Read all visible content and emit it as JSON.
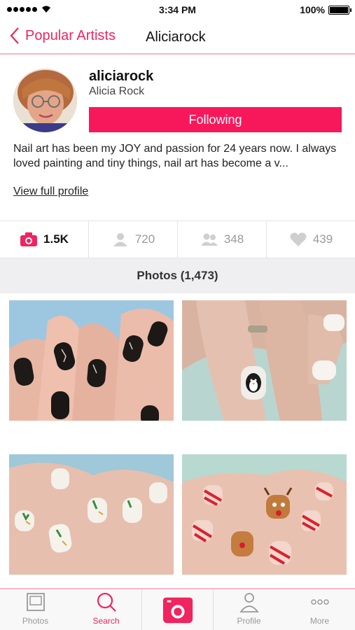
{
  "status_bar": {
    "time": "3:34 PM",
    "battery": "100%"
  },
  "nav": {
    "back_label": "Popular Artists",
    "title": "Aliciarock"
  },
  "profile": {
    "username": "aliciarock",
    "full_name": "Alicia Rock",
    "follow_button": "Following",
    "bio": "Nail art has been my JOY and passion for 24  years now. I always loved painting and tiny things, nail art has become a v...",
    "view_full_profile": "View full profile"
  },
  "stats": [
    {
      "icon": "camera-icon",
      "value": "1.5K"
    },
    {
      "icon": "user-icon",
      "value": "720"
    },
    {
      "icon": "users-icon",
      "value": "348"
    },
    {
      "icon": "heart-icon",
      "value": "439"
    }
  ],
  "photos_header": "Photos (1,473)",
  "tabs": [
    {
      "label": "Photos",
      "icon": "photos-icon"
    },
    {
      "label": "Search",
      "icon": "search-icon"
    },
    {
      "label": "",
      "icon": "camera-icon"
    },
    {
      "label": "Profile",
      "icon": "profile-icon"
    },
    {
      "label": "More",
      "icon": "more-icon"
    }
  ],
  "colors": {
    "accent": "#f0245f",
    "button": "#f7185b",
    "divider": "#f4b7cb"
  }
}
